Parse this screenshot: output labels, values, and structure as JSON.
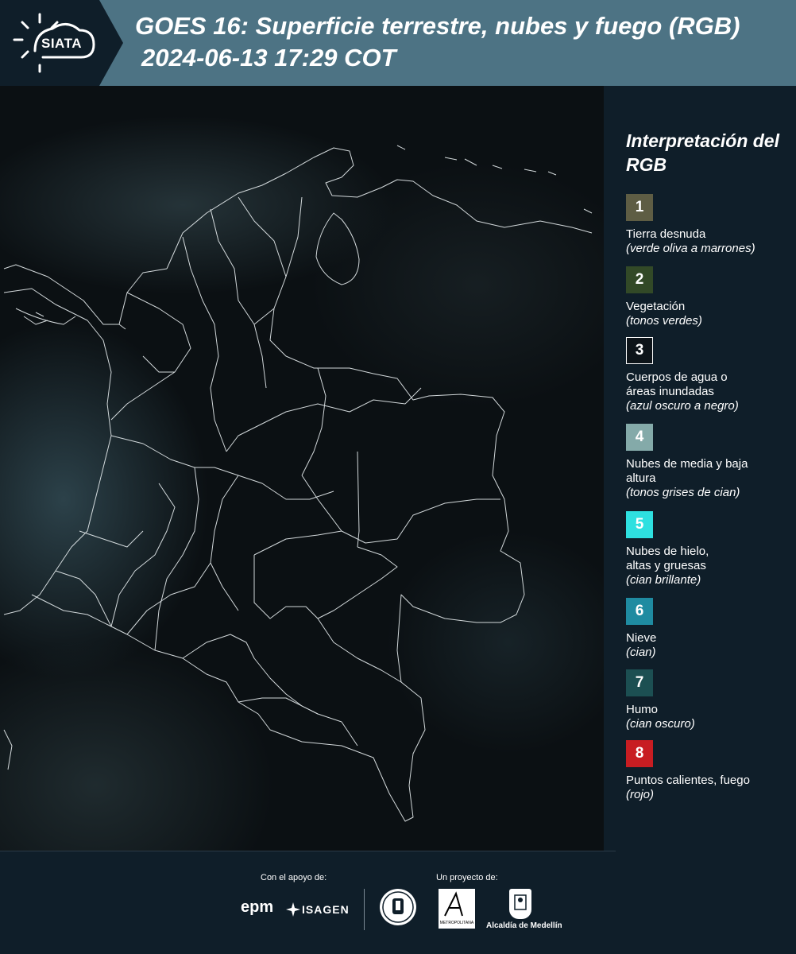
{
  "header": {
    "logo_text": "SIATA",
    "title": "GOES 16: Superficie terrestre, nubes y fuego (RGB)",
    "subtitle": "2024-06-13 17:29 COT"
  },
  "legend": {
    "title": "Interpretación del RGB",
    "items": [
      {
        "number": "1",
        "label": "Tierra desnuda",
        "desc": "(verde oliva a marrones)",
        "color": "#5e5d44"
      },
      {
        "number": "2",
        "label": "Vegetación",
        "desc": "(tonos verdes)",
        "color": "#324927"
      },
      {
        "number": "3",
        "label": "Cuerpos de agua o áreas inundadas",
        "desc": "(azul oscuro a negro)",
        "color": "#0d1419"
      },
      {
        "number": "4",
        "label": "Nubes de media y baja altura",
        "desc": "(tonos grises de cian)",
        "color": "#84aaa9"
      },
      {
        "number": "5",
        "label": "Nubes de hielo, altas y gruesas",
        "desc": "(cian brillante)",
        "color": "#2ee0e0"
      },
      {
        "number": "6",
        "label": "Nieve",
        "desc": "(cian)",
        "color": "#1f8ba1"
      },
      {
        "number": "7",
        "label": "Humo",
        "desc": "(cian oscuro)",
        "color": "#1c4f52"
      },
      {
        "number": "8",
        "label": "Puntos calientes, fuego",
        "desc": "(rojo)",
        "color": "#c81d22"
      }
    ]
  },
  "footer": {
    "support_label": "Con el apoyo de:",
    "project_label": "Un proyecto de:",
    "epm": "epm",
    "isagen": "ISAGEN",
    "area_text": "METROPOLITANA",
    "alcaldia": "Alcaldía de Medellín"
  }
}
